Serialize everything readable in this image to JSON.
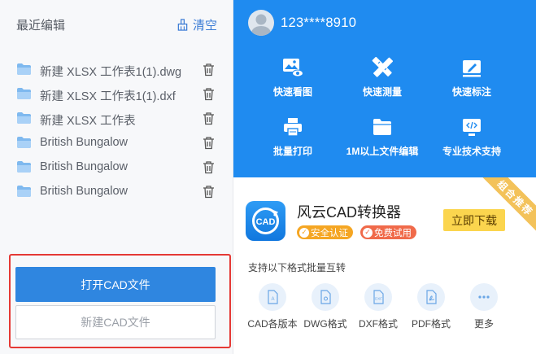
{
  "recent": {
    "title": "最近编辑",
    "clear_label": "清空",
    "files": [
      {
        "name": "新建 XLSX 工作表1(1).dwg"
      },
      {
        "name": "新建 XLSX 工作表1(1).dxf"
      },
      {
        "name": "新建 XLSX 工作表"
      },
      {
        "name": "British Bungalow"
      },
      {
        "name": "British Bungalow"
      },
      {
        "name": "British Bungalow"
      }
    ],
    "open_button": "打开CAD文件",
    "new_button": "新建CAD文件"
  },
  "user": {
    "phone": "123****8910"
  },
  "features": [
    {
      "label": "快速看图",
      "icon": "image-eye-icon"
    },
    {
      "label": "快速测量",
      "icon": "ruler-pencil-icon"
    },
    {
      "label": "快速标注",
      "icon": "annotate-pen-icon"
    },
    {
      "label": "批量打印",
      "icon": "printer-icon"
    },
    {
      "label": "1M以上文件编辑",
      "icon": "folder-icon"
    },
    {
      "label": "专业技术支持",
      "icon": "code-screen-icon"
    }
  ],
  "promo": {
    "ribbon": "组合推荐",
    "app_name": "风云CAD转换器",
    "logo_text": "CAD",
    "badge_safe": "安全认证",
    "badge_free": "免费试用",
    "download": "立即下载",
    "support_text": "支持以下格式批量互转",
    "formats": [
      {
        "label": "CAD各版本",
        "icon": "cad-file-icon"
      },
      {
        "label": "DWG格式",
        "icon": "dwg-file-icon"
      },
      {
        "label": "DXF格式",
        "icon": "dxf-file-icon",
        "tag": "DXF"
      },
      {
        "label": "PDF格式",
        "icon": "pdf-file-icon"
      },
      {
        "label": "更多",
        "icon": "more-dots-icon"
      }
    ]
  },
  "colors": {
    "accent_blue": "#1f8bf0",
    "button_blue": "#2f86e0",
    "highlight_red": "#e53935",
    "download_yellow": "#fbd54e",
    "ribbon_gold": "#f3c25a"
  }
}
